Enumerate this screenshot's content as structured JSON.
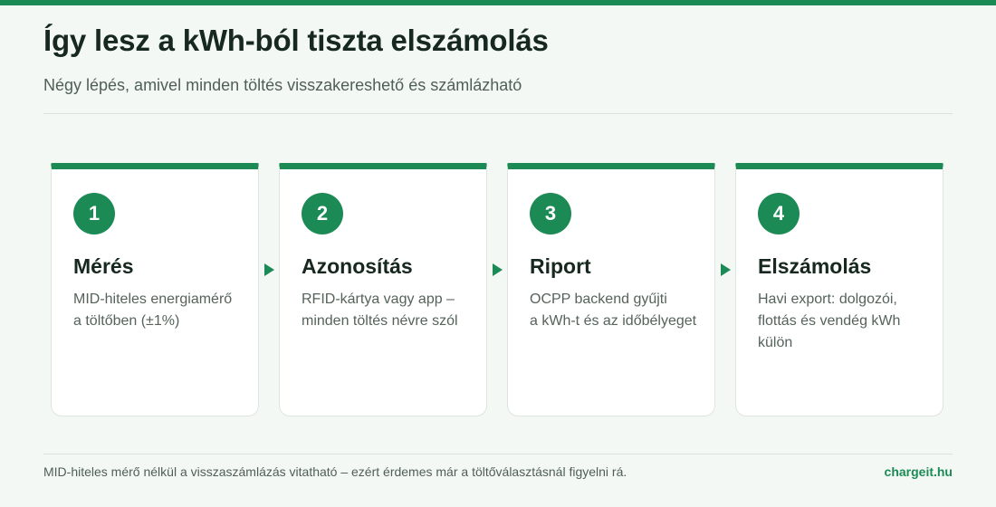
{
  "header": {
    "title": "Így lesz a kWh-ból tiszta elszámolás",
    "subtitle": "Négy lépés, amivel minden töltés visszakereshető és számlázható"
  },
  "steps": [
    {
      "number": "1",
      "title": "Mérés",
      "description": "MID-hiteles energiamérő\na töltőben (±1%)"
    },
    {
      "number": "2",
      "title": "Azonosítás",
      "description": "RFID-kártya vagy app –\nminden töltés névre szól"
    },
    {
      "number": "3",
      "title": "Riport",
      "description": "OCPP backend gyűjti\na kWh-t és az időbélyeget"
    },
    {
      "number": "4",
      "title": "Elszámolás",
      "description": "Havi export: dolgozói,\nflottás és vendég kWh külön"
    }
  ],
  "footer": {
    "note": "MID-hiteles mérő nélkül a visszaszámlázás vitatható – ezért érdemes már a töltőválasztásnál figyelni rá.",
    "brand": "chargeit.hu"
  },
  "colors": {
    "accent": "#1c8a55",
    "background": "#f4f8f5",
    "text_dark": "#16281f",
    "text_muted": "#55635b"
  },
  "icons": {
    "arrow": "arrow-right-icon"
  }
}
